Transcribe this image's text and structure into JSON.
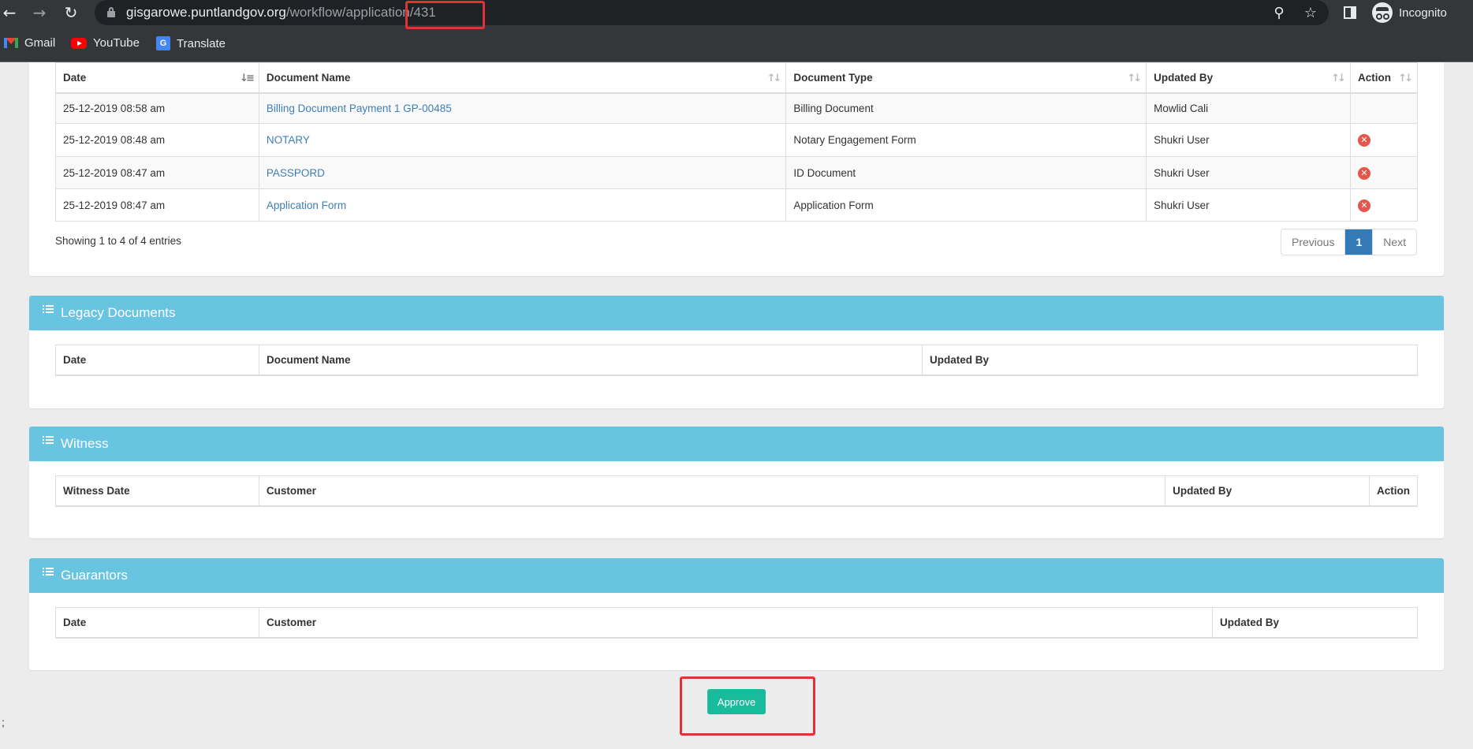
{
  "browser": {
    "url_host": "gisgarowe.puntlandgov.org",
    "url_path": "/workflow/application/431",
    "profile_label": "Incognito",
    "bookmarks": [
      {
        "label": "Gmail",
        "icon": "gmail-icon"
      },
      {
        "label": "YouTube",
        "icon": "youtube-icon"
      },
      {
        "label": "Translate",
        "icon": "translate-icon"
      }
    ]
  },
  "documents": {
    "columns": [
      "Date",
      "Document Name",
      "Document Type",
      "Updated By",
      "Action"
    ],
    "rows": [
      {
        "date": "25-12-2019 08:58 am",
        "name": "Billing Document Payment 1 GP-00485",
        "type": "Billing Document",
        "updated_by": "Mowlid Cali",
        "deletable": false
      },
      {
        "date": "25-12-2019 08:48 am",
        "name": "NOTARY",
        "type": "Notary Engagement Form",
        "updated_by": "Shukri User",
        "deletable": true
      },
      {
        "date": "25-12-2019 08:47 am",
        "name": "PASSPORD",
        "type": "ID Document",
        "updated_by": "Shukri User",
        "deletable": true
      },
      {
        "date": "25-12-2019 08:47 am",
        "name": "Application Form",
        "type": "Application Form",
        "updated_by": "Shukri User",
        "deletable": true
      }
    ],
    "showing": "Showing 1 to 4 of 4 entries",
    "pagination": {
      "previous": "Previous",
      "current": "1",
      "next": "Next"
    }
  },
  "legacy": {
    "title": "Legacy Documents",
    "columns": [
      "Date",
      "Document Name",
      "Updated By"
    ]
  },
  "witness": {
    "title": "Witness",
    "columns": [
      "Witness Date",
      "Customer",
      "Updated By",
      "Action"
    ]
  },
  "guarantors": {
    "title": "Guarantors",
    "columns": [
      "Date",
      "Customer",
      "Updated By"
    ]
  },
  "approve_label": "Approve",
  "stray_text": ";",
  "colors": {
    "header_bg": "#69c4e2",
    "approve_bg": "#18bc9c",
    "link": "#3c7fb8",
    "delete": "#e4574a",
    "highlight": "#e03333"
  }
}
